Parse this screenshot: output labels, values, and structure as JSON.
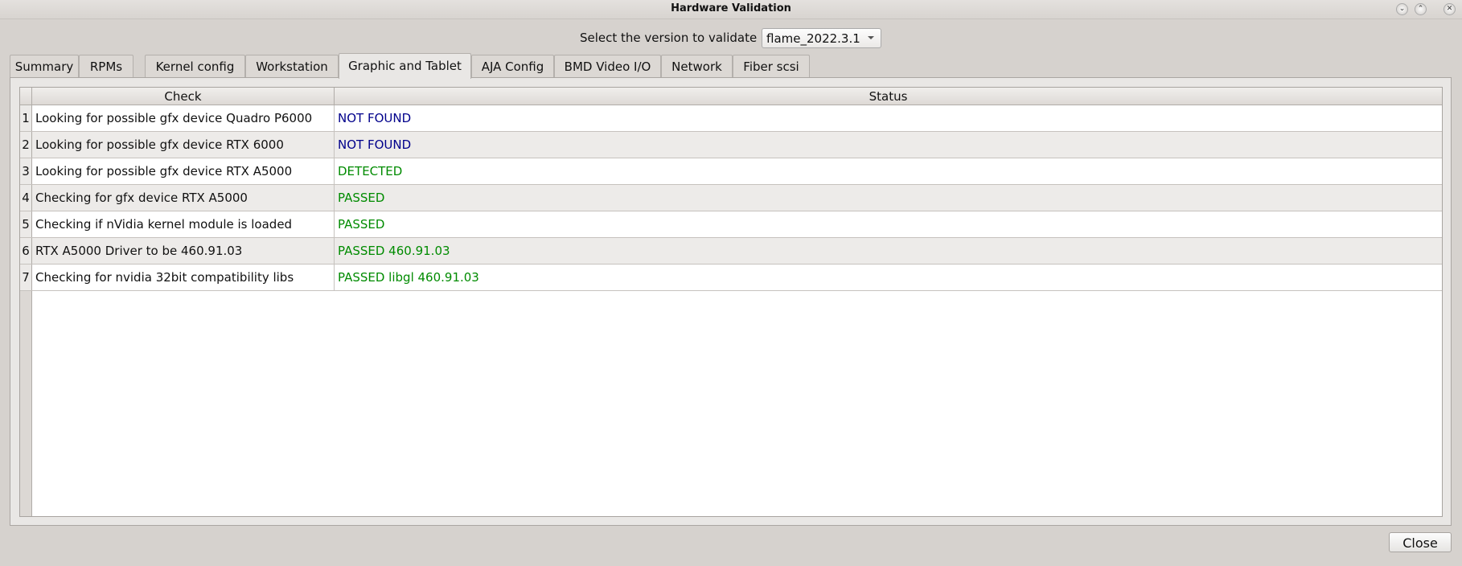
{
  "window": {
    "title": "Hardware Validation",
    "buttons": [
      "minimize",
      "maximize",
      "close"
    ]
  },
  "version": {
    "label": "Select the version to validate",
    "selected": "flame_2022.3.1"
  },
  "tabs": [
    "Summary",
    "RPMs",
    "Kernel config",
    "Workstation",
    "Graphic and Tablet",
    "AJA Config",
    "BMD Video I/O",
    "Network",
    "Fiber scsi"
  ],
  "active_tab": "Graphic and Tablet",
  "table": {
    "headers": [
      "Check",
      "Status"
    ],
    "rows": [
      {
        "n": "1",
        "check": "Looking for possible gfx device Quadro P6000",
        "status": "NOT FOUND",
        "color": "#00008b"
      },
      {
        "n": "2",
        "check": "Looking for possible gfx device RTX 6000",
        "status": "NOT FOUND",
        "color": "#00008b"
      },
      {
        "n": "3",
        "check": "Looking for possible gfx device RTX A5000",
        "status": "DETECTED",
        "color": "#008b00"
      },
      {
        "n": "4",
        "check": "Checking for gfx device RTX A5000",
        "status": "PASSED",
        "color": "#008b00"
      },
      {
        "n": "5",
        "check": "Checking if nVidia kernel module is loaded",
        "status": "PASSED",
        "color": "#008b00"
      },
      {
        "n": "6",
        "check": "RTX A5000 Driver to be 460.91.03",
        "status": "PASSED 460.91.03",
        "color": "#008b00"
      },
      {
        "n": "7",
        "check": "Checking for nvidia 32bit compatibility libs",
        "status": "PASSED libgl 460.91.03",
        "color": "#008b00"
      }
    ]
  },
  "close_label": "Close"
}
